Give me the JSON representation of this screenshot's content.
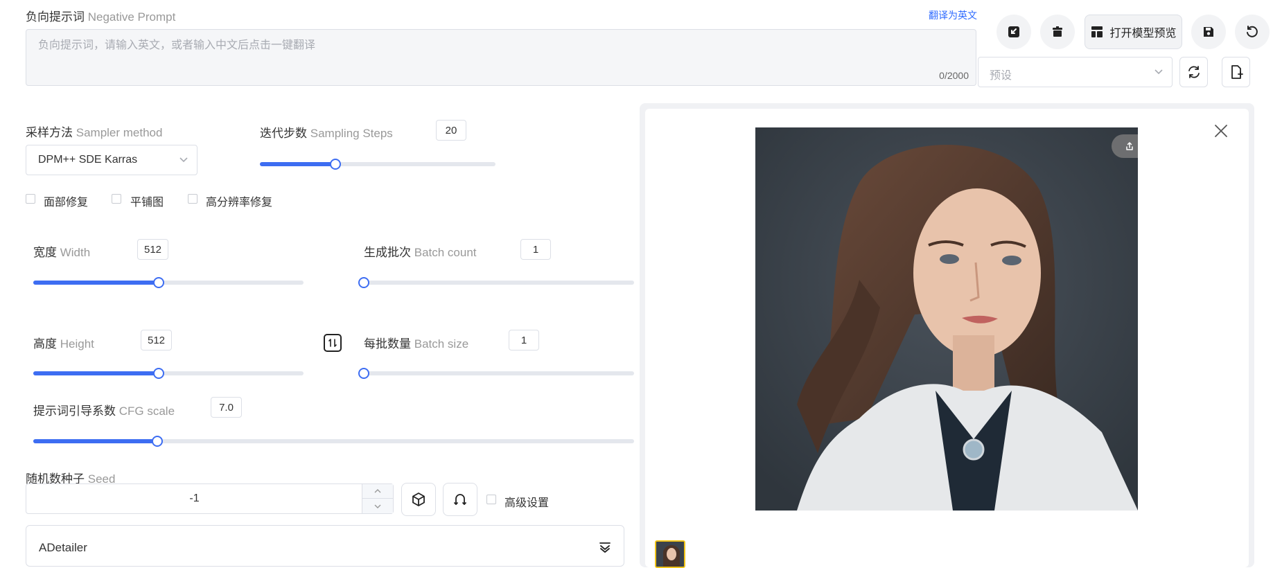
{
  "negative_prompt": {
    "label_cn": "负向提示词",
    "label_en": "Negative Prompt",
    "translate_link": "翻译为英文",
    "placeholder": "负向提示词，请输入英文，或者输入中文后点击一键翻译",
    "counter": "0/2000"
  },
  "toolbar": {
    "open_preview_label": "打开模型预览",
    "preset_placeholder": "预设"
  },
  "sampler": {
    "label_cn": "采样方法",
    "label_en": "Sampler method",
    "value": "DPM++ SDE Karras"
  },
  "steps": {
    "label_cn": "迭代步数",
    "label_en": "Sampling Steps",
    "value": "20",
    "fraction": 0.32
  },
  "options": {
    "face_fix": "面部修复",
    "tiling": "平铺图",
    "hires_fix": "高分辨率修复",
    "advanced": "高级设置"
  },
  "width": {
    "label_cn": "宽度",
    "label_en": "Width",
    "value": "512",
    "fraction": 0.465
  },
  "height": {
    "label_cn": "高度",
    "label_en": "Height",
    "value": "512",
    "fraction": 0.465
  },
  "batch_count": {
    "label_cn": "生成批次",
    "label_en": "Batch count",
    "value": "1",
    "fraction": 0.0
  },
  "batch_size": {
    "label_cn": "每批数量",
    "label_en": "Batch size",
    "value": "1",
    "fraction": 0.0
  },
  "cfg": {
    "label_cn": "提示词引导系数",
    "label_en": "CFG scale",
    "value": "7.0",
    "fraction": 0.207
  },
  "seed": {
    "label_cn": "随机数种子",
    "label_en": "Seed",
    "value": "-1"
  },
  "adetailer": {
    "title": "ADetailer"
  },
  "preview": {
    "share_label": "分享"
  },
  "colors": {
    "accent": "#3d6df2",
    "link": "#2f6bff"
  }
}
